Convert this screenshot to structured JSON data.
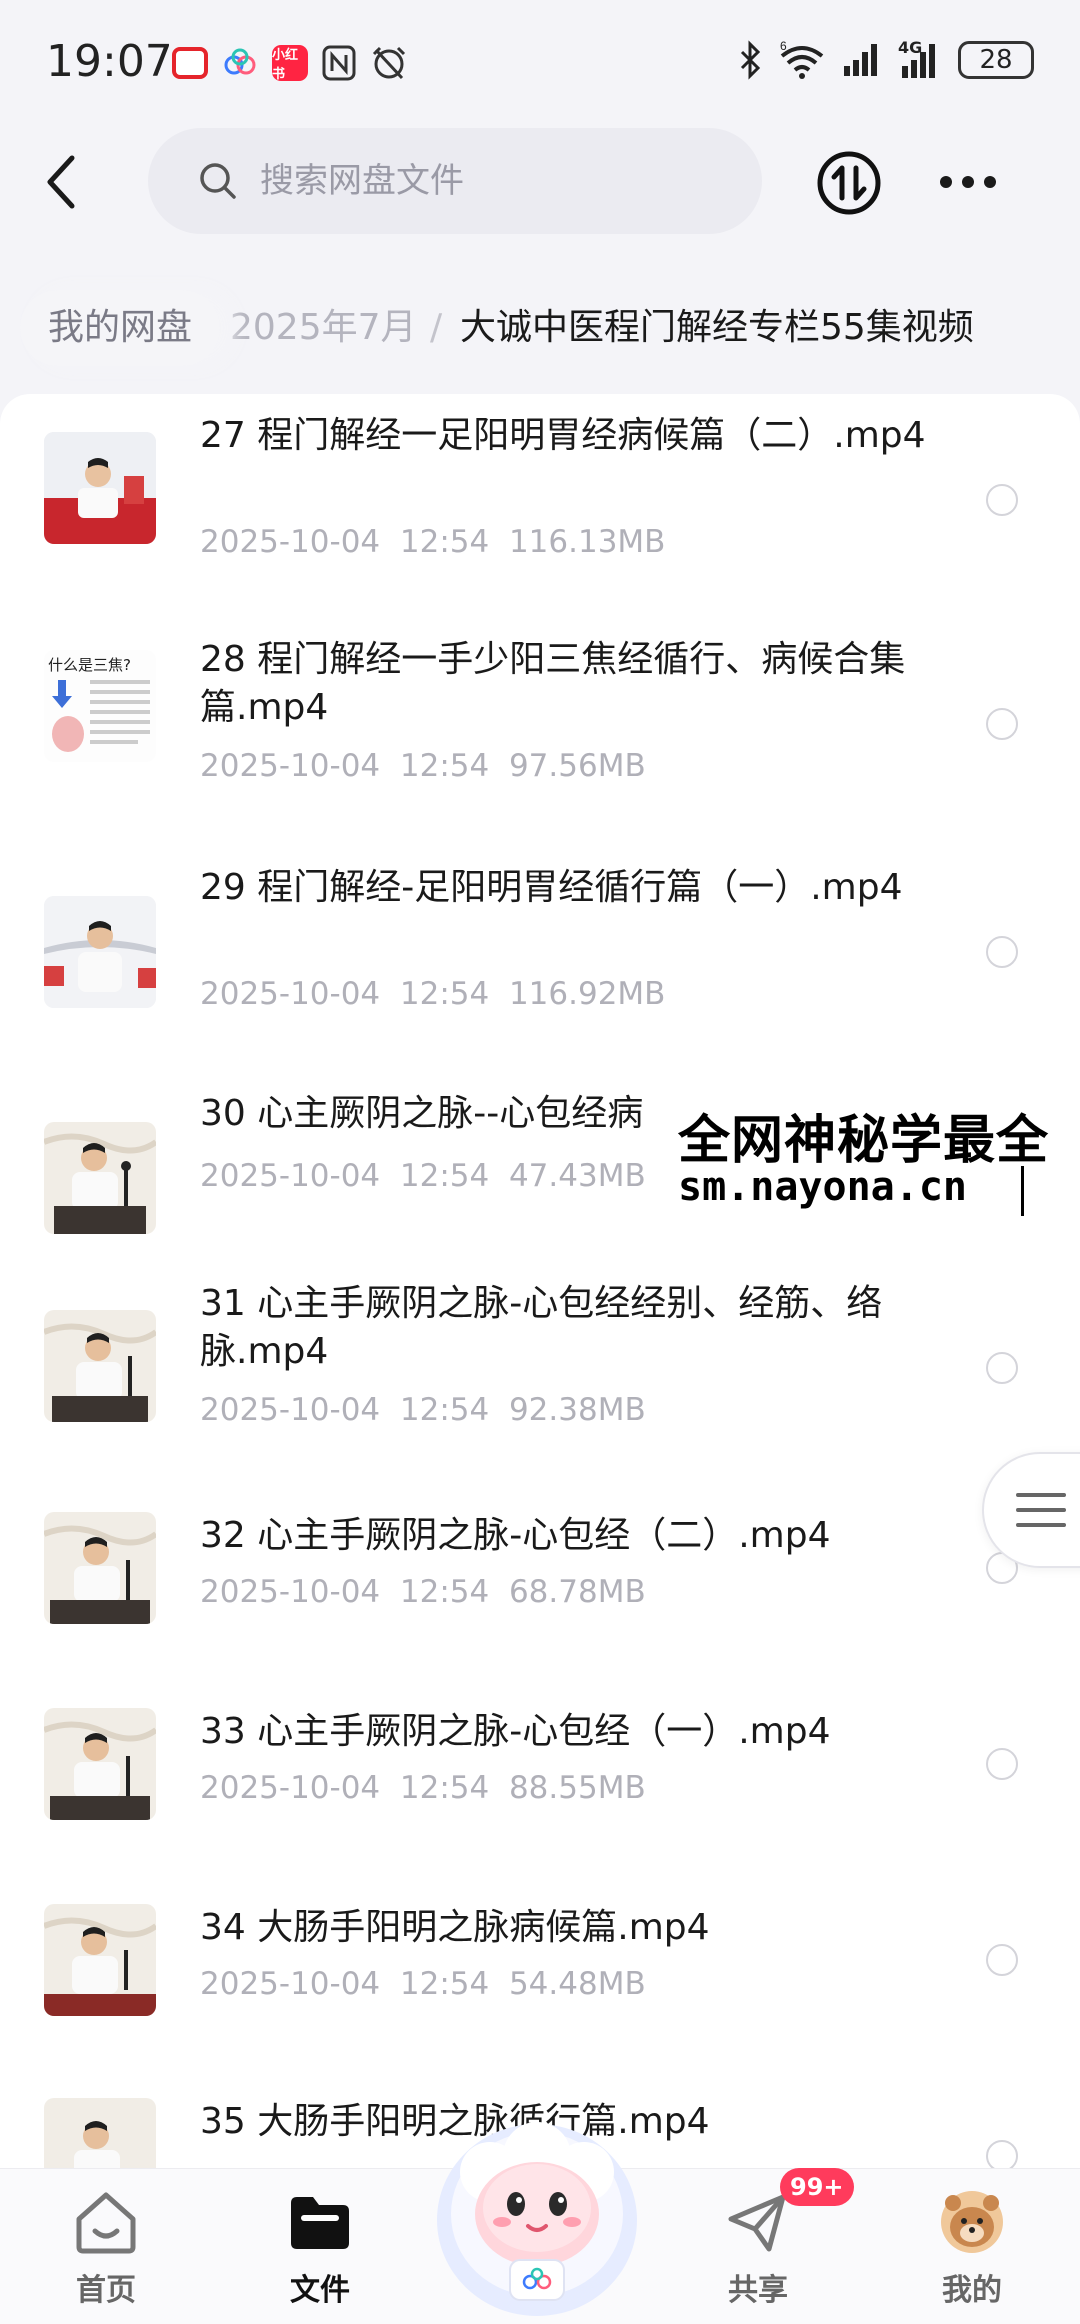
{
  "status_bar": {
    "time": "19:07",
    "app_badge_text": "小红书",
    "network": "4G",
    "signal_sup": "6",
    "battery": "28"
  },
  "search": {
    "placeholder": "搜索网盘文件"
  },
  "breadcrumb": {
    "root": "我的网盘",
    "middle": "2025年7月",
    "separator": "/",
    "current": "大诚中医程门解经专栏55集视频"
  },
  "files": [
    {
      "name": "27 程门解经一足阳明胃经病候篇（二）.mp4",
      "date": "2025-10-04",
      "time": "12:54",
      "size": "116.13MB"
    },
    {
      "name": "28 程门解经一手少阳三焦经循行、病候合集篇.mp4",
      "date": "2025-10-04",
      "time": "12:54",
      "size": "97.56MB"
    },
    {
      "name": "29 程门解经-足阳明胃经循行篇（一）.mp4",
      "date": "2025-10-04",
      "time": "12:54",
      "size": "116.92MB"
    },
    {
      "name": "30 心主厥阴之脉--心包经病",
      "date": "2025-10-04",
      "time": "12:54",
      "size": "47.43MB"
    },
    {
      "name": "31 心主手厥阴之脉-心包经经别、经筋、络脉.mp4",
      "date": "2025-10-04",
      "time": "12:54",
      "size": "92.38MB"
    },
    {
      "name": "32 心主手厥阴之脉-心包经（二）.mp4",
      "date": "2025-10-04",
      "time": "12:54",
      "size": "68.78MB"
    },
    {
      "name": "33 心主手厥阴之脉-心包经（一）.mp4",
      "date": "2025-10-04",
      "time": "12:54",
      "size": "88.55MB"
    },
    {
      "name": "34 大肠手阳明之脉病候篇.mp4",
      "date": "2025-10-04",
      "time": "12:54",
      "size": "54.48MB"
    },
    {
      "name": "35 大肠手阳明之脉循行篇.mp4",
      "date": "",
      "time": "",
      "size": ""
    }
  ],
  "thumbs": {
    "sanjiao_title": "什么是三焦?"
  },
  "watermark": {
    "line1": "全网神秘学最全",
    "line2": "sm.nayona.cn"
  },
  "nav": {
    "home": "首页",
    "files": "文件",
    "share": "共享",
    "mine": "我的",
    "share_badge": "99+"
  },
  "colors": {
    "badge": "#ff3b5c",
    "text_primary": "#1a1a1a",
    "text_meta": "#b0b0b8"
  }
}
